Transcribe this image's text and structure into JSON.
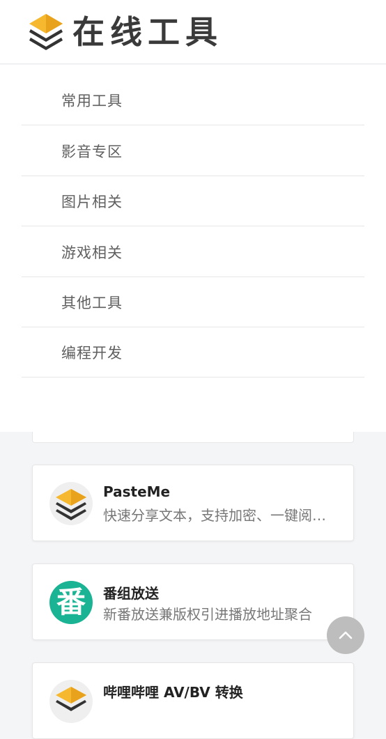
{
  "header": {
    "logo_text": "在线工具",
    "logo_icon": "layers-icon"
  },
  "menu": {
    "items": [
      {
        "label": "常用工具"
      },
      {
        "label": "影音专区"
      },
      {
        "label": "图片相关"
      },
      {
        "label": "游戏相关"
      },
      {
        "label": "其他工具"
      },
      {
        "label": "编程开发"
      }
    ]
  },
  "cards": [
    {
      "title": "PasteMe",
      "desc": "快速分享文本，支持加密、一键阅后即焚",
      "icon": "layers-icon"
    },
    {
      "title": "番组放送",
      "desc": "新番放送兼版权引进播放地址聚合",
      "icon": "bangumi-icon",
      "icon_char": "番"
    },
    {
      "title": "哔哩哔哩 AV/BV 转换",
      "icon": "layers-icon"
    }
  ],
  "colors": {
    "logo_yellow": "#f5b82e",
    "logo_dark": "#333333",
    "bangumi_green": "#1ab394",
    "back_top": "#bdbdbd"
  },
  "back_top_icon": "chevron-up-icon"
}
